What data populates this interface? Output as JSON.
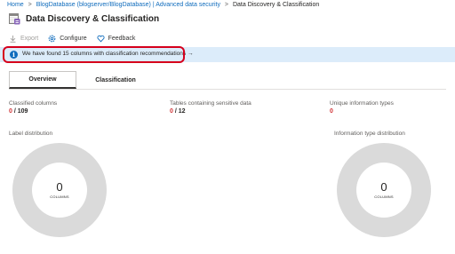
{
  "breadcrumb": {
    "items": [
      "Home",
      "BlogDatabase (blogserver/BlogDatabase) | Advanced data security",
      "Data Discovery & Classification"
    ],
    "separator": ">"
  },
  "header": {
    "title": "Data Discovery & Classification",
    "icon": "classification-table-icon"
  },
  "toolbar": {
    "export_label": "Export",
    "configure_label": "Configure",
    "feedback_label": "Feedback"
  },
  "banner": {
    "text": "We have found 15 columns with classification recommendations",
    "arrow": "→",
    "info_glyph": "i"
  },
  "tabs": [
    {
      "label": "Overview",
      "active": true
    },
    {
      "label": "Classification",
      "active": false
    }
  ],
  "stats": [
    {
      "label": "Classified columns",
      "value": "0",
      "total": " / 109"
    },
    {
      "label": "Tables containing sensitive data",
      "value": "0",
      "total": " / 12"
    },
    {
      "label": "Unique information types",
      "value": "0",
      "total": ""
    }
  ],
  "charts": [
    {
      "label": "Label distribution",
      "count": "0",
      "unit": "COLUMNS"
    },
    {
      "label": "Information type distribution",
      "count": "0",
      "unit": "COLUMNS"
    }
  ],
  "colors": {
    "accent": "#0f6cbd",
    "banner_bg": "#dcecfa",
    "highlight": "#d6001c",
    "stat_red": "#d13438",
    "donut": "#dadada"
  }
}
